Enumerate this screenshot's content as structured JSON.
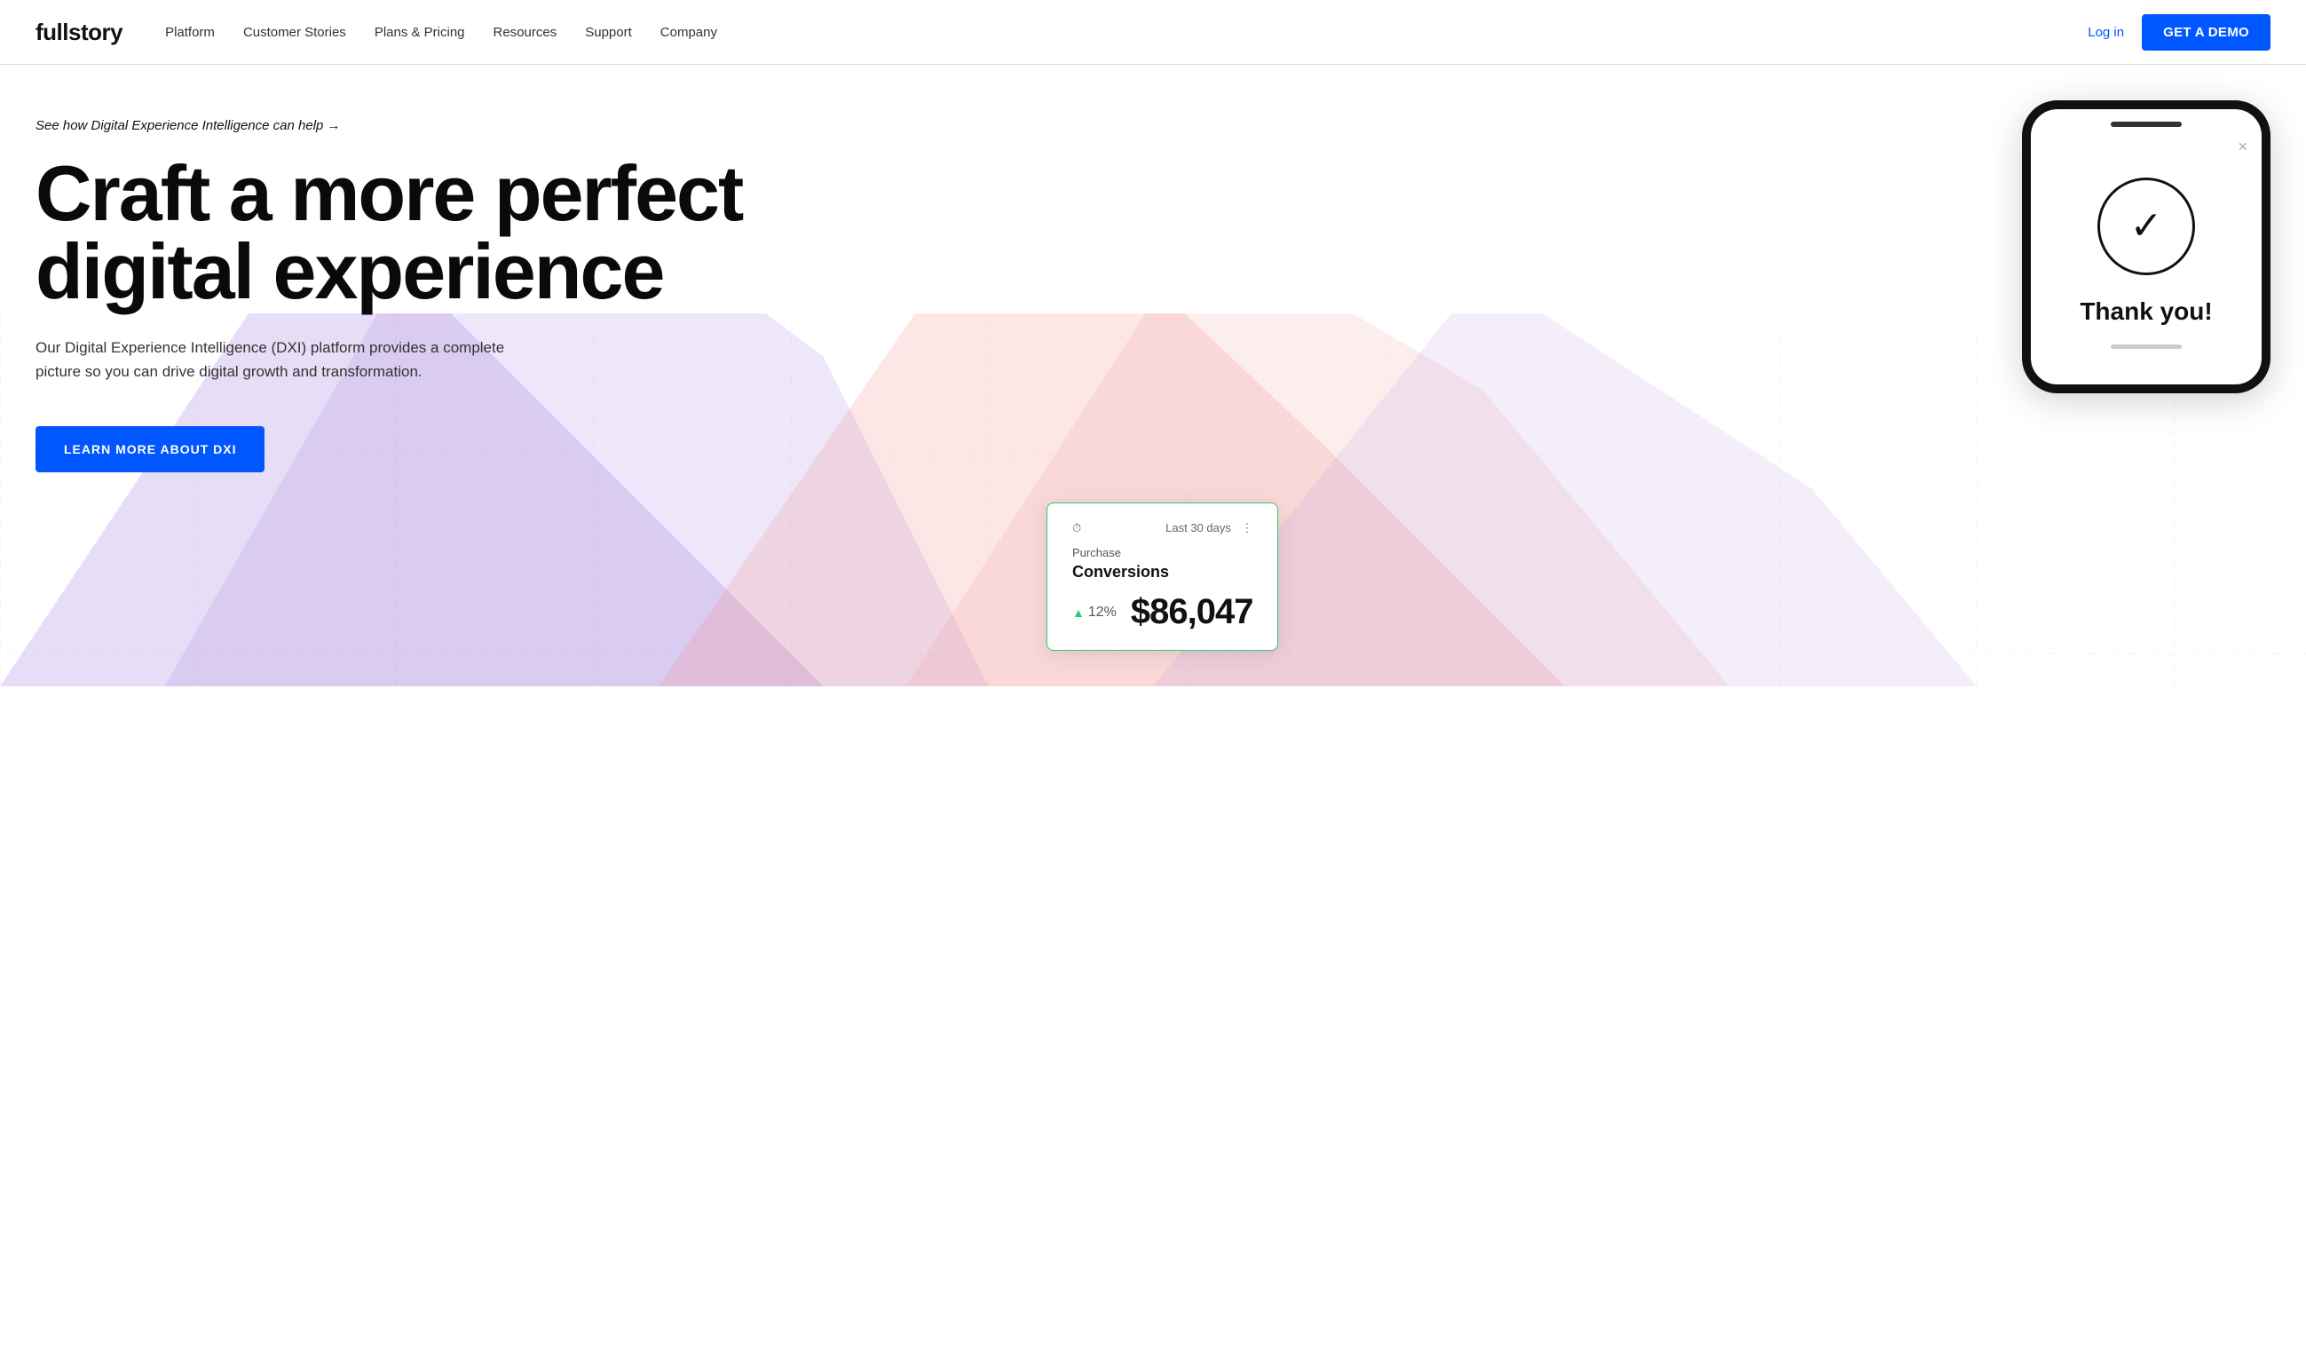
{
  "nav": {
    "logo": "fullstory",
    "links": [
      {
        "id": "platform",
        "label": "Platform"
      },
      {
        "id": "customer-stories",
        "label": "Customer Stories"
      },
      {
        "id": "plans-pricing",
        "label": "Plans & Pricing"
      },
      {
        "id": "resources",
        "label": "Resources"
      },
      {
        "id": "support",
        "label": "Support"
      },
      {
        "id": "company",
        "label": "Company"
      }
    ],
    "login_label": "Log in",
    "demo_label": "GET A DEMO"
  },
  "hero": {
    "badge": "See how Digital Experience Intelligence can help →",
    "headline_line1": "Craft a more perfect",
    "headline_line2": "digital experience",
    "subtext": "Our Digital Experience Intelligence (DXI) platform provides a complete picture so you can drive digital growth and transformation.",
    "cta_label": "LEARN MORE ABOUT DXI"
  },
  "conversion_card": {
    "icon": "⏱",
    "time_range": "Last 30 days",
    "more_icon": "⋮",
    "label": "Purchase",
    "title": "Conversions",
    "percent": "12%",
    "value": "$86,047"
  },
  "phone": {
    "close_icon": "×",
    "check_icon": "✓",
    "thank_you": "Thank you!"
  },
  "colors": {
    "accent_blue": "#0057ff",
    "green": "#2ecc71",
    "black": "#111"
  }
}
